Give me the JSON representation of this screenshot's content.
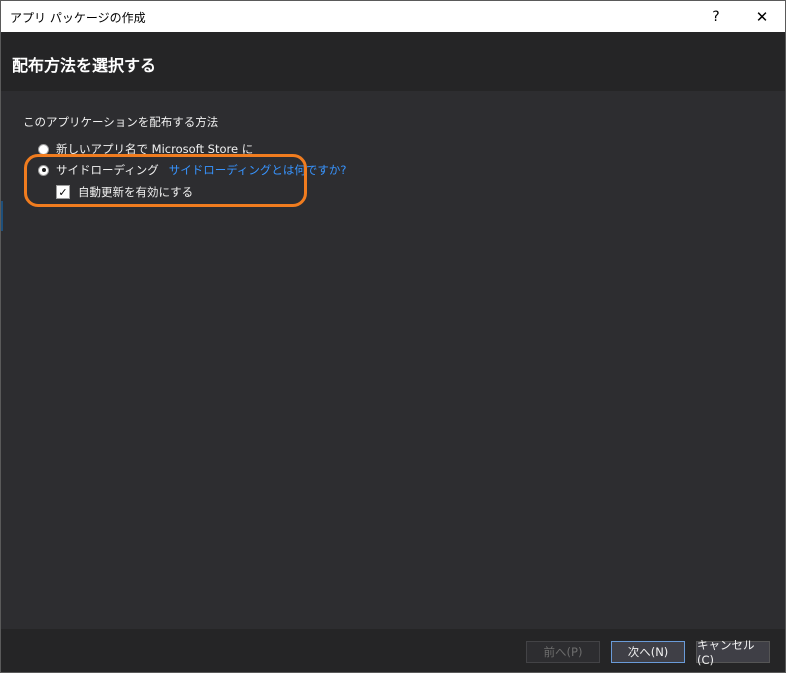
{
  "window": {
    "title": "アプリ パッケージの作成",
    "help_label": "?",
    "close_label": "✕"
  },
  "header": {
    "heading": "配布方法を選択する"
  },
  "main": {
    "prompt": "このアプリケーションを配布する方法",
    "options": [
      {
        "label": "新しいアプリ名で Microsoft Store に",
        "selected": false
      },
      {
        "label": "サイドローディング",
        "selected": true,
        "link": "サイドローディングとは何ですか?"
      }
    ],
    "auto_update": {
      "label": "自動更新を有効にする",
      "checked": true,
      "check_glyph": "✓"
    }
  },
  "footer": {
    "prev_label": "前へ(P)",
    "next_label": "次へ(N)",
    "cancel_label": "キャンセル(C)"
  },
  "colors": {
    "highlight": "#f07c1f",
    "link": "#3794ff",
    "background": "#2d2d30"
  }
}
